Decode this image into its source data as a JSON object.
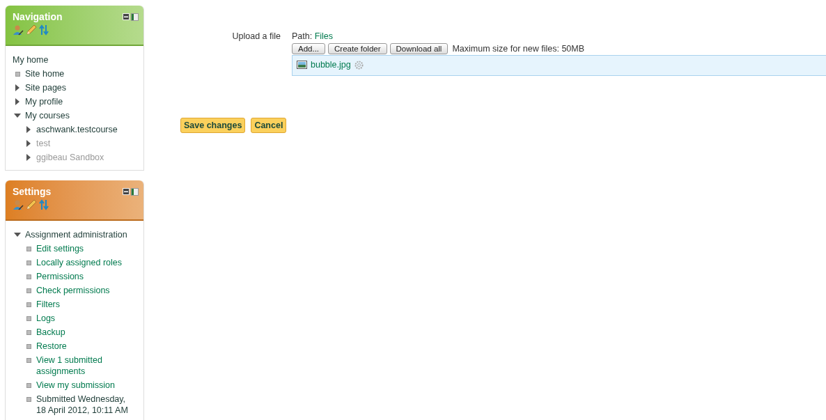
{
  "blocks": [
    {
      "title": "Navigation",
      "color": "#84c341",
      "items": [
        {
          "label": "My home",
          "kind": "none",
          "link": false,
          "dimmed": false,
          "children": [
            {
              "label": "Site home",
              "kind": "leaf",
              "link": false,
              "dimmed": false
            },
            {
              "label": "Site pages",
              "kind": "branch",
              "expanded": false,
              "link": false,
              "dimmed": false
            },
            {
              "label": "My profile",
              "kind": "branch",
              "expanded": false,
              "link": false,
              "dimmed": false
            },
            {
              "label": "My courses",
              "kind": "branch",
              "expanded": true,
              "link": false,
              "dimmed": false,
              "children": [
                {
                  "label": "aschwank.testcourse",
                  "kind": "branch",
                  "expanded": false,
                  "link": false,
                  "dimmed": false
                },
                {
                  "label": "test",
                  "kind": "branch",
                  "expanded": false,
                  "link": false,
                  "dimmed": true
                },
                {
                  "label": "ggibeau Sandbox",
                  "kind": "branch",
                  "expanded": false,
                  "link": false,
                  "dimmed": true
                }
              ]
            }
          ]
        }
      ]
    },
    {
      "title": "Settings",
      "color": "#dd7f22",
      "items": [
        {
          "label": "Assignment administration",
          "kind": "branch",
          "expanded": true,
          "link": false,
          "dimmed": false,
          "children": [
            {
              "label": "Edit settings",
              "kind": "leaf",
              "link": true,
              "dimmed": false
            },
            {
              "label": "Locally assigned roles",
              "kind": "leaf",
              "link": true,
              "dimmed": false
            },
            {
              "label": "Permissions",
              "kind": "leaf",
              "link": true,
              "dimmed": false
            },
            {
              "label": "Check permissions",
              "kind": "leaf",
              "link": true,
              "dimmed": false
            },
            {
              "label": "Filters",
              "kind": "leaf",
              "link": true,
              "dimmed": false
            },
            {
              "label": "Logs",
              "kind": "leaf",
              "link": true,
              "dimmed": false
            },
            {
              "label": "Backup",
              "kind": "leaf",
              "link": true,
              "dimmed": false
            },
            {
              "label": "Restore",
              "kind": "leaf",
              "link": true,
              "dimmed": false
            },
            {
              "label": "View 1 submitted assignments",
              "kind": "leaf",
              "link": true,
              "dimmed": false
            },
            {
              "label": "View my submission",
              "kind": "leaf",
              "link": true,
              "dimmed": false
            },
            {
              "label": "Submitted Wednesday, 18 April 2012, 10:11 AM",
              "kind": "leaf",
              "link": false,
              "dimmed": false
            }
          ]
        }
      ]
    }
  ],
  "form": {
    "label": "Upload a file",
    "path_label": "Path:",
    "path_link": "Files",
    "toolbar": [
      "Add...",
      "Create folder",
      "Download all"
    ],
    "max_size": "Maximum size for new files: 50MB",
    "files": [
      {
        "name": "bubble.jpg"
      }
    ],
    "buttons": [
      "Save changes",
      "Cancel"
    ]
  }
}
